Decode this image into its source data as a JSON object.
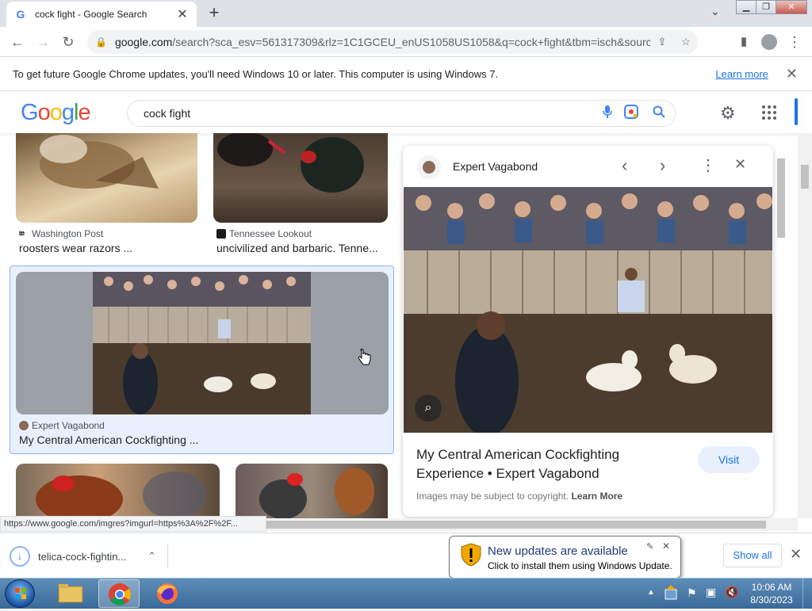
{
  "browser": {
    "tab_title": "cock fight - Google Search",
    "url_host": "google.com",
    "url_rest": "/search?sca_esv=561317309&rlz=1C1GCEU_enUS1058US1058&q=cock+fight&tbm=isch&source=ln...",
    "infobar_message": "To get future Google Chrome updates, you'll need Windows 10 or later. This computer is using Windows 7.",
    "infobar_link": "Learn more",
    "status_url": "https://www.google.com/imgres?imgurl=https%3A%2F%2F..."
  },
  "search": {
    "logo": "Google",
    "query": "cock fight"
  },
  "results": [
    {
      "source": "Washington Post",
      "caption": "roosters wear razors ..."
    },
    {
      "source": "Tennessee Lookout",
      "caption": "uncivilized and barbaric. Tenne..."
    },
    {
      "source": "Expert Vagabond",
      "caption": "My Central American Cockfighting ..."
    }
  ],
  "panel": {
    "source": "Expert Vagabond",
    "title": "My Central American Cockfighting Experience • Expert Vagabond",
    "visit_label": "Visit",
    "copyright": "Images may be subject to copyright.",
    "learn_more": "Learn More"
  },
  "downloads": {
    "file_name": "telica-cock-fightin...",
    "show_all": "Show all"
  },
  "notification": {
    "title": "New updates are available",
    "body": "Click to install them using Windows Update."
  },
  "taskbar": {
    "time": "10:06 AM",
    "date": "8/30/2023"
  },
  "colors": {
    "accent": "#1a73e8",
    "selected_tile_bg": "#e8f0fe",
    "selected_tile_border": "#8ab4f8"
  }
}
